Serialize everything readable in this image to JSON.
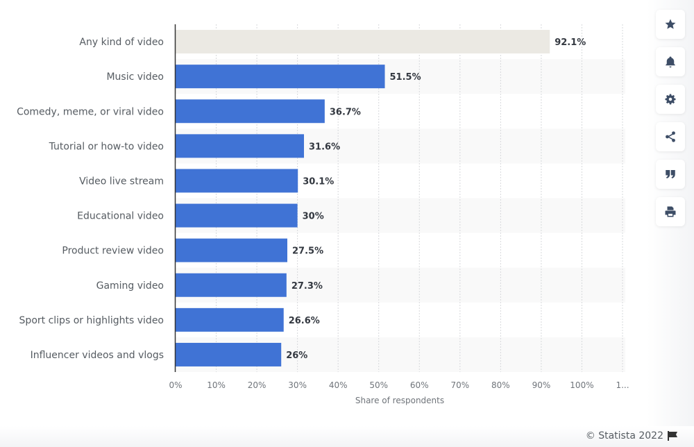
{
  "chart_data": {
    "type": "bar",
    "orientation": "horizontal",
    "categories": [
      "Any kind of video",
      "Music video",
      "Comedy, meme, or viral video",
      "Tutorial or how-to video",
      "Video live stream",
      "Educational video",
      "Product review video",
      "Gaming video",
      "Sport clips or highlights video",
      "Influencer videos and vlogs"
    ],
    "values": [
      92.1,
      51.5,
      36.7,
      31.6,
      30.1,
      30,
      27.5,
      27.3,
      26.6,
      26
    ],
    "value_labels": [
      "92.1%",
      "51.5%",
      "36.7%",
      "31.6%",
      "30.1%",
      "30%",
      "27.5%",
      "27.3%",
      "26.6%",
      "26%"
    ],
    "highlight_index": 0,
    "colors": {
      "bar": "#4073d5",
      "highlight_bar": "#ebe9e3",
      "band": "#f9f9f9"
    },
    "title": "",
    "xlabel": "Share of respondents",
    "ylabel": "",
    "xlim": [
      0,
      110
    ],
    "x_ticks": [
      0,
      10,
      20,
      30,
      40,
      50,
      60,
      70,
      80,
      90,
      100,
      110
    ],
    "x_tick_labels": [
      "0%",
      "10%",
      "20%",
      "30%",
      "40%",
      "50%",
      "60%",
      "70%",
      "80%",
      "90%",
      "100%",
      "1..."
    ],
    "grid": true,
    "legend": "none"
  },
  "toolbar": {
    "buttons": [
      {
        "name": "favorite-button",
        "icon": "star-icon"
      },
      {
        "name": "notification-button",
        "icon": "bell-icon"
      },
      {
        "name": "settings-button",
        "icon": "gear-icon"
      },
      {
        "name": "share-button",
        "icon": "share-icon"
      },
      {
        "name": "cite-button",
        "icon": "quote-icon"
      },
      {
        "name": "print-button",
        "icon": "printer-icon"
      }
    ]
  },
  "footer": {
    "copyright": "© Statista 2022",
    "flag_icon": "flag-icon"
  }
}
